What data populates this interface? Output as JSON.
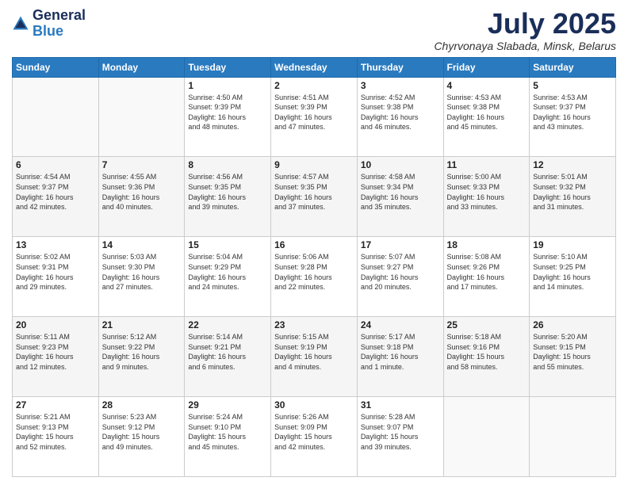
{
  "logo": {
    "general": "General",
    "blue": "Blue"
  },
  "header": {
    "month_year": "July 2025",
    "location": "Chyrvonaya Slabada, Minsk, Belarus"
  },
  "days_of_week": [
    "Sunday",
    "Monday",
    "Tuesday",
    "Wednesday",
    "Thursday",
    "Friday",
    "Saturday"
  ],
  "weeks": [
    {
      "shade": "white",
      "days": [
        {
          "num": "",
          "info": ""
        },
        {
          "num": "",
          "info": ""
        },
        {
          "num": "1",
          "info": "Sunrise: 4:50 AM\nSunset: 9:39 PM\nDaylight: 16 hours\nand 48 minutes."
        },
        {
          "num": "2",
          "info": "Sunrise: 4:51 AM\nSunset: 9:39 PM\nDaylight: 16 hours\nand 47 minutes."
        },
        {
          "num": "3",
          "info": "Sunrise: 4:52 AM\nSunset: 9:38 PM\nDaylight: 16 hours\nand 46 minutes."
        },
        {
          "num": "4",
          "info": "Sunrise: 4:53 AM\nSunset: 9:38 PM\nDaylight: 16 hours\nand 45 minutes."
        },
        {
          "num": "5",
          "info": "Sunrise: 4:53 AM\nSunset: 9:37 PM\nDaylight: 16 hours\nand 43 minutes."
        }
      ]
    },
    {
      "shade": "shade",
      "days": [
        {
          "num": "6",
          "info": "Sunrise: 4:54 AM\nSunset: 9:37 PM\nDaylight: 16 hours\nand 42 minutes."
        },
        {
          "num": "7",
          "info": "Sunrise: 4:55 AM\nSunset: 9:36 PM\nDaylight: 16 hours\nand 40 minutes."
        },
        {
          "num": "8",
          "info": "Sunrise: 4:56 AM\nSunset: 9:35 PM\nDaylight: 16 hours\nand 39 minutes."
        },
        {
          "num": "9",
          "info": "Sunrise: 4:57 AM\nSunset: 9:35 PM\nDaylight: 16 hours\nand 37 minutes."
        },
        {
          "num": "10",
          "info": "Sunrise: 4:58 AM\nSunset: 9:34 PM\nDaylight: 16 hours\nand 35 minutes."
        },
        {
          "num": "11",
          "info": "Sunrise: 5:00 AM\nSunset: 9:33 PM\nDaylight: 16 hours\nand 33 minutes."
        },
        {
          "num": "12",
          "info": "Sunrise: 5:01 AM\nSunset: 9:32 PM\nDaylight: 16 hours\nand 31 minutes."
        }
      ]
    },
    {
      "shade": "white",
      "days": [
        {
          "num": "13",
          "info": "Sunrise: 5:02 AM\nSunset: 9:31 PM\nDaylight: 16 hours\nand 29 minutes."
        },
        {
          "num": "14",
          "info": "Sunrise: 5:03 AM\nSunset: 9:30 PM\nDaylight: 16 hours\nand 27 minutes."
        },
        {
          "num": "15",
          "info": "Sunrise: 5:04 AM\nSunset: 9:29 PM\nDaylight: 16 hours\nand 24 minutes."
        },
        {
          "num": "16",
          "info": "Sunrise: 5:06 AM\nSunset: 9:28 PM\nDaylight: 16 hours\nand 22 minutes."
        },
        {
          "num": "17",
          "info": "Sunrise: 5:07 AM\nSunset: 9:27 PM\nDaylight: 16 hours\nand 20 minutes."
        },
        {
          "num": "18",
          "info": "Sunrise: 5:08 AM\nSunset: 9:26 PM\nDaylight: 16 hours\nand 17 minutes."
        },
        {
          "num": "19",
          "info": "Sunrise: 5:10 AM\nSunset: 9:25 PM\nDaylight: 16 hours\nand 14 minutes."
        }
      ]
    },
    {
      "shade": "shade",
      "days": [
        {
          "num": "20",
          "info": "Sunrise: 5:11 AM\nSunset: 9:23 PM\nDaylight: 16 hours\nand 12 minutes."
        },
        {
          "num": "21",
          "info": "Sunrise: 5:12 AM\nSunset: 9:22 PM\nDaylight: 16 hours\nand 9 minutes."
        },
        {
          "num": "22",
          "info": "Sunrise: 5:14 AM\nSunset: 9:21 PM\nDaylight: 16 hours\nand 6 minutes."
        },
        {
          "num": "23",
          "info": "Sunrise: 5:15 AM\nSunset: 9:19 PM\nDaylight: 16 hours\nand 4 minutes."
        },
        {
          "num": "24",
          "info": "Sunrise: 5:17 AM\nSunset: 9:18 PM\nDaylight: 16 hours\nand 1 minute."
        },
        {
          "num": "25",
          "info": "Sunrise: 5:18 AM\nSunset: 9:16 PM\nDaylight: 15 hours\nand 58 minutes."
        },
        {
          "num": "26",
          "info": "Sunrise: 5:20 AM\nSunset: 9:15 PM\nDaylight: 15 hours\nand 55 minutes."
        }
      ]
    },
    {
      "shade": "white",
      "days": [
        {
          "num": "27",
          "info": "Sunrise: 5:21 AM\nSunset: 9:13 PM\nDaylight: 15 hours\nand 52 minutes."
        },
        {
          "num": "28",
          "info": "Sunrise: 5:23 AM\nSunset: 9:12 PM\nDaylight: 15 hours\nand 49 minutes."
        },
        {
          "num": "29",
          "info": "Sunrise: 5:24 AM\nSunset: 9:10 PM\nDaylight: 15 hours\nand 45 minutes."
        },
        {
          "num": "30",
          "info": "Sunrise: 5:26 AM\nSunset: 9:09 PM\nDaylight: 15 hours\nand 42 minutes."
        },
        {
          "num": "31",
          "info": "Sunrise: 5:28 AM\nSunset: 9:07 PM\nDaylight: 15 hours\nand 39 minutes."
        },
        {
          "num": "",
          "info": ""
        },
        {
          "num": "",
          "info": ""
        }
      ]
    }
  ]
}
